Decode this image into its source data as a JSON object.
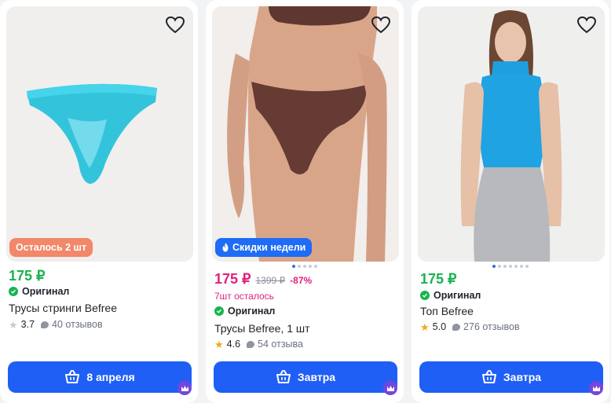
{
  "cards": [
    {
      "badge": "Осталось 2 шт",
      "price": "175 ₽",
      "original": "Оригинал",
      "title": "Трусы стринги Befree",
      "rating": "3.7",
      "reviews": "40 отзывов",
      "delivery": "8 апреля"
    },
    {
      "badge": "Скидки недели",
      "price": "175 ₽",
      "old_price": "1399 ₽",
      "discount": "-87%",
      "stock": "7шт осталось",
      "original": "Оригинал",
      "title": "Трусы Befree, 1 шт",
      "rating": "4.6",
      "reviews": "54 отзыва",
      "delivery": "Завтра"
    },
    {
      "price": "175 ₽",
      "original": "Оригинал",
      "title": "Топ Befree",
      "rating": "5.0",
      "reviews": "276 отзывов",
      "delivery": "Завтра"
    }
  ],
  "colors": {
    "green_price": "#19b350",
    "pink_price": "#e0217a",
    "button": "#1f5ff5",
    "badge_orange": "#f2876a",
    "badge_blue": "#1f6cf6",
    "star_gold": "#f5a623"
  },
  "icons": [
    "heart-icon",
    "check-icon",
    "star-icon",
    "review-bubble-icon",
    "basket-icon",
    "crown-icon",
    "flame-icon"
  ]
}
